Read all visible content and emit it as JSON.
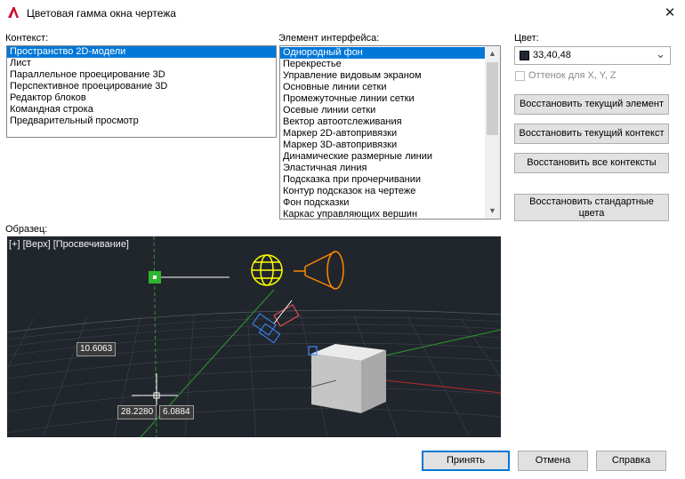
{
  "window": {
    "title": "Цветовая гамма окна чертежа",
    "close_glyph": "✕",
    "app_icon": "autocad-a-icon"
  },
  "context": {
    "label": "Контекст:",
    "items": [
      "Пространство 2D-модели",
      "Лист",
      "Параллельное проецирование 3D",
      "Перспективное проецирование 3D",
      "Редактор блоков",
      "Командная строка",
      "Предварительный просмотр"
    ],
    "selected_index": 0
  },
  "element": {
    "label": "Элемент интерфейса:",
    "items": [
      "Однородный фон",
      "Перекрестье",
      "Управление видовым экраном",
      "Основные линии сетки",
      "Промежуточные линии сетки",
      "Осевые линии сетки",
      "Вектор автоотслеживания",
      "Маркер 2D-автопривязки",
      "Маркер 3D-автопривязки",
      "Динамические размерные линии",
      "Эластичная линия",
      "Подсказка при прочерчивании",
      "Контур подсказок на чертеже",
      "Фон подсказки",
      "Каркас управляющих вершин"
    ],
    "selected_index": 0,
    "scroll_up_glyph": "▲",
    "scroll_down_glyph": "▼"
  },
  "color": {
    "label": "Цвет:",
    "value": "33,40,48",
    "swatch_hex": "#212830",
    "dropdown_glyph": "⌄",
    "tint_label": "Оттенок для X, Y, Z",
    "tint_checked": false
  },
  "buttons": {
    "restore_current_element": "Восстановить текущий элемент",
    "restore_current_context": "Восстановить текущий контекст",
    "restore_all_contexts": "Восстановить все контексты",
    "restore_default_line1": "Восстановить стандартные",
    "restore_default_line2": "цвета",
    "apply": "Принять",
    "cancel": "Отмена",
    "help": "Справка"
  },
  "preview": {
    "label": "Образец:",
    "viewport_label": "[+] [Верх] [Просвечивание]",
    "dim_length": "10.6063",
    "coord_x": "28.2280",
    "coord_y": "6.0884"
  },
  "colors": {
    "accent": "#0078d7",
    "preview_background": "#21262d",
    "glyph_green": "#2db52d",
    "glyph_yellow": "#ffff00",
    "glyph_orange": "#ff8800"
  }
}
